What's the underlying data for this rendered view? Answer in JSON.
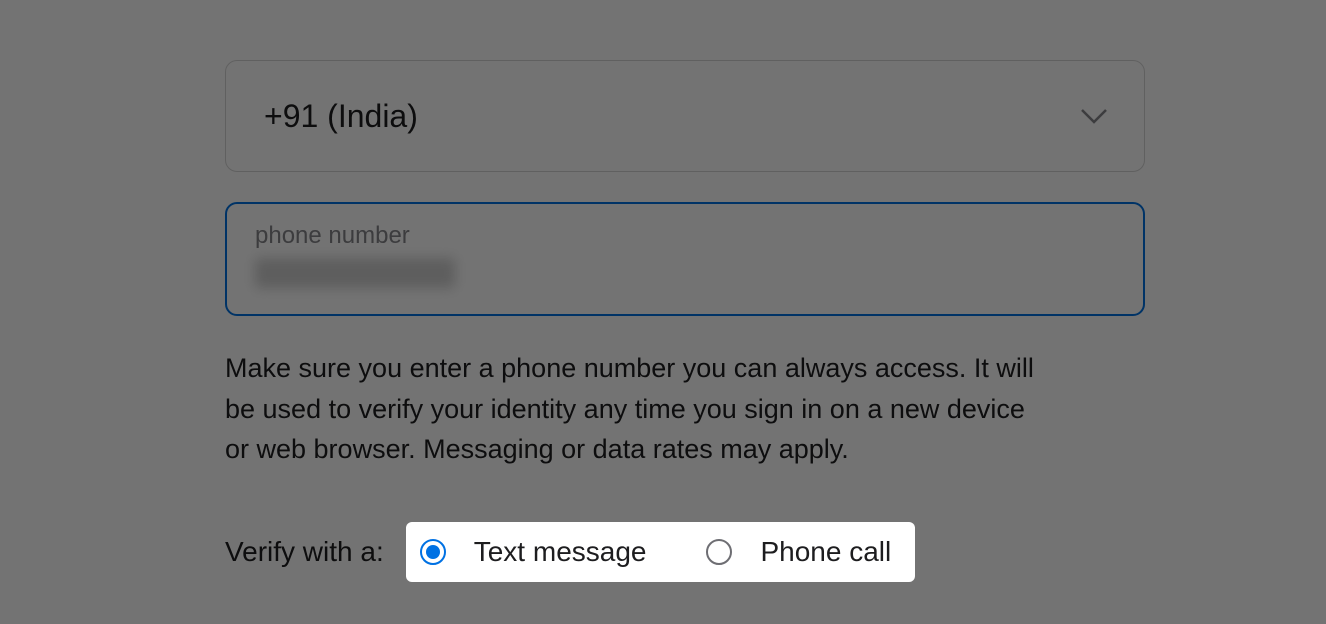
{
  "country": {
    "selected": "+91 (India)"
  },
  "phone": {
    "label": "phone number"
  },
  "helper": "Make sure you enter a phone number you can always access. It will be used to verify your identity any time you sign in on a new device or web browser. Messaging or data rates may apply.",
  "verify": {
    "label": "Verify with a:",
    "options": {
      "text": "Text message",
      "call": "Phone call"
    },
    "selected": "text"
  }
}
